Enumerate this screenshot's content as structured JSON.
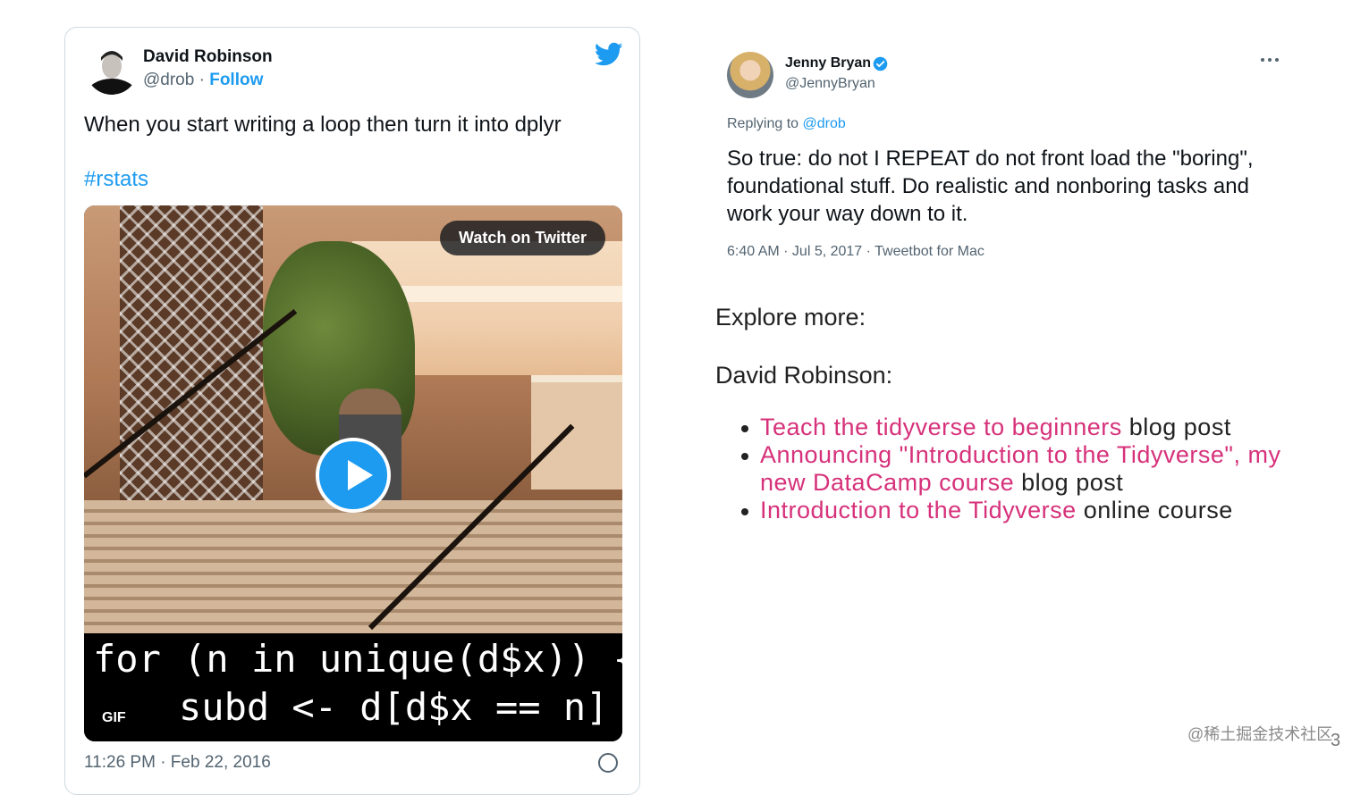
{
  "left_tweet": {
    "author_name": "David Robinson",
    "handle": "@drob",
    "separator": " · ",
    "follow_label": "Follow",
    "text": "When you start writing a loop then turn it into dplyr",
    "hashtag": "#rstats",
    "media": {
      "watch_label": "Watch on Twitter",
      "code_line_1": "for (n in unique(d$x)) {",
      "code_line_2": "subd <- d[d$x == n]",
      "gif_badge": "GIF"
    },
    "timestamp_partial": "11:26 PM · Feb 22, 2016"
  },
  "reply_tweet": {
    "author_name": "Jenny Bryan",
    "handle": "@JennyBryan",
    "replying_prefix": "Replying to ",
    "replying_to": "@drob",
    "text": "So true: do not I REPEAT do not front load the \"boring\", foundational stuff. Do realistic and nonboring tasks and work your way down to it.",
    "meta": "6:40 AM · Jul 5, 2017 · Tweetbot for Mac"
  },
  "explore": {
    "heading": "Explore more:",
    "author": "David Robinson:",
    "items": [
      {
        "link": "Teach the tidyverse to beginners",
        "suffix": " blog post"
      },
      {
        "link": "Announcing \"Introduction to the Tidyverse\", my new DataCamp course",
        "suffix": " blog post"
      },
      {
        "link": "Introduction to the Tidyverse",
        "suffix": " online course"
      }
    ]
  },
  "watermark": "@稀土掘金技术社区",
  "slide_number": "3",
  "colors": {
    "twitter_blue": "#1d9bf0",
    "link_pink": "#d6317a"
  }
}
